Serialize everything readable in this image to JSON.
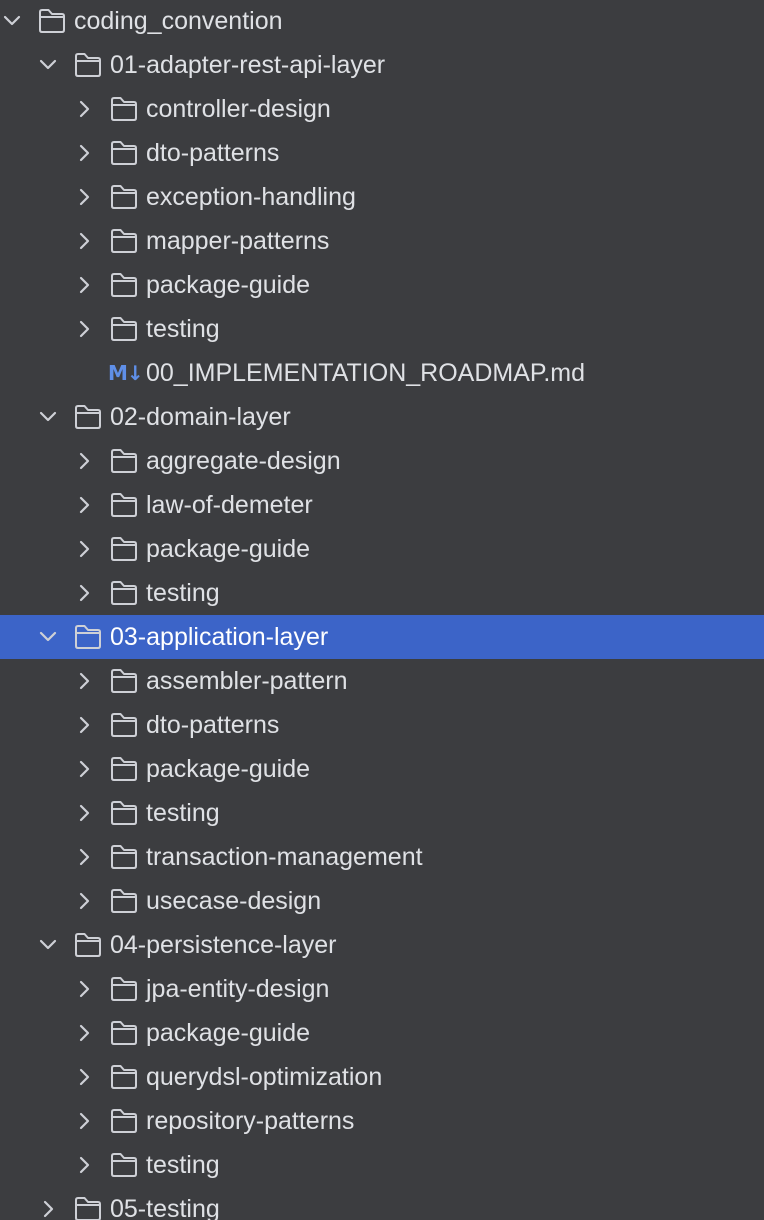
{
  "tree": [
    {
      "label": "coding_convention",
      "depth": 0,
      "kind": "folder",
      "expanded": true
    },
    {
      "label": "01-adapter-rest-api-layer",
      "depth": 1,
      "kind": "folder",
      "expanded": true
    },
    {
      "label": "controller-design",
      "depth": 2,
      "kind": "folder",
      "expanded": false
    },
    {
      "label": "dto-patterns",
      "depth": 2,
      "kind": "folder",
      "expanded": false
    },
    {
      "label": "exception-handling",
      "depth": 2,
      "kind": "folder",
      "expanded": false
    },
    {
      "label": "mapper-patterns",
      "depth": 2,
      "kind": "folder",
      "expanded": false
    },
    {
      "label": "package-guide",
      "depth": 2,
      "kind": "folder",
      "expanded": false
    },
    {
      "label": "testing",
      "depth": 2,
      "kind": "folder",
      "expanded": false
    },
    {
      "label": "00_IMPLEMENTATION_ROADMAP.md",
      "depth": 2,
      "kind": "markdown",
      "icon_text": "M↓"
    },
    {
      "label": "02-domain-layer",
      "depth": 1,
      "kind": "folder",
      "expanded": true
    },
    {
      "label": "aggregate-design",
      "depth": 2,
      "kind": "folder",
      "expanded": false
    },
    {
      "label": "law-of-demeter",
      "depth": 2,
      "kind": "folder",
      "expanded": false
    },
    {
      "label": "package-guide",
      "depth": 2,
      "kind": "folder",
      "expanded": false
    },
    {
      "label": "testing",
      "depth": 2,
      "kind": "folder",
      "expanded": false
    },
    {
      "label": "03-application-layer",
      "depth": 1,
      "kind": "folder",
      "expanded": true,
      "selected": true
    },
    {
      "label": "assembler-pattern",
      "depth": 2,
      "kind": "folder",
      "expanded": false
    },
    {
      "label": "dto-patterns",
      "depth": 2,
      "kind": "folder",
      "expanded": false
    },
    {
      "label": "package-guide",
      "depth": 2,
      "kind": "folder",
      "expanded": false
    },
    {
      "label": "testing",
      "depth": 2,
      "kind": "folder",
      "expanded": false
    },
    {
      "label": "transaction-management",
      "depth": 2,
      "kind": "folder",
      "expanded": false
    },
    {
      "label": "usecase-design",
      "depth": 2,
      "kind": "folder",
      "expanded": false
    },
    {
      "label": "04-persistence-layer",
      "depth": 1,
      "kind": "folder",
      "expanded": true
    },
    {
      "label": "jpa-entity-design",
      "depth": 2,
      "kind": "folder",
      "expanded": false
    },
    {
      "label": "package-guide",
      "depth": 2,
      "kind": "folder",
      "expanded": false
    },
    {
      "label": "querydsl-optimization",
      "depth": 2,
      "kind": "folder",
      "expanded": false
    },
    {
      "label": "repository-patterns",
      "depth": 2,
      "kind": "folder",
      "expanded": false
    },
    {
      "label": "testing",
      "depth": 2,
      "kind": "folder",
      "expanded": false
    },
    {
      "label": "05-testing",
      "depth": 1,
      "kind": "folder",
      "expanded": false
    }
  ],
  "colors": {
    "background": "#3c3d40",
    "text": "#dfe1e5",
    "selection": "#3c64c8",
    "icon_stroke": "#ced0d6",
    "markdown_icon": "#5f8fe8"
  },
  "icons": {
    "folder": "folder-icon",
    "markdown": "markdown-file-icon",
    "expanded": "chevron-down-icon",
    "collapsed": "chevron-right-icon"
  }
}
